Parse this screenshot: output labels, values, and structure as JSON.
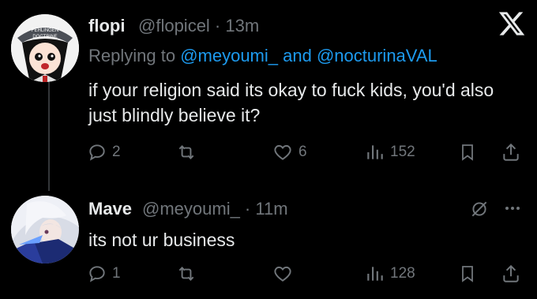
{
  "tweet1": {
    "name": "flopi",
    "handle_time": "@flopicel · 13m",
    "replying_prefix": "Replying to ",
    "mention1": "@meyoumi_",
    "and": " and ",
    "mention2": "@nocturinaVAL",
    "text": "if your religion said its okay to fuck kids, you'd also just blindly believe it?",
    "avatar_label_top": "FEHLINGEN",
    "avatar_label_bottom": "DOCTRINE",
    "replies": "2",
    "retweets": "",
    "likes": "6",
    "views": "152"
  },
  "tweet2": {
    "name": "Mave",
    "handle_time": "@meyoumi_ · 11m",
    "text": "its not ur business",
    "replies": "1",
    "retweets": "",
    "likes": "",
    "views": "128"
  },
  "icons": {
    "x_logo": "x-logo-icon",
    "reply": "reply-icon",
    "retweet": "retweet-icon",
    "like": "heart-icon",
    "views": "views-icon",
    "bookmark": "bookmark-icon",
    "share": "share-icon",
    "grok": "grok-icon",
    "more": "more-icon"
  },
  "colors": {
    "background": "#000000",
    "text": "#e7e9ea",
    "muted": "#71767b",
    "accent": "#1d9bf0"
  }
}
